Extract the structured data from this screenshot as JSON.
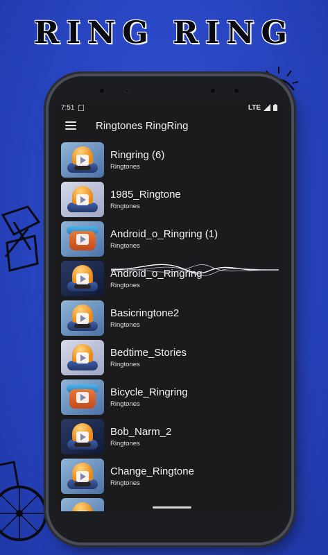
{
  "banner": {
    "title": "RING RING"
  },
  "status_bar": {
    "time": "7:51",
    "network": "LTE"
  },
  "toolbar": {
    "title": "Ringtones RingRing",
    "menu_icon": "hamburger-menu-icon"
  },
  "ringtones": [
    {
      "name": "Ringring (6)",
      "category": "Ringtones",
      "thumb": "bell"
    },
    {
      "name": "1985_Ringtone",
      "category": "Ringtones",
      "thumb": "alarm"
    },
    {
      "name": "Android_o_Ringring (1)",
      "category": "Ringtones",
      "thumb": "phone"
    },
    {
      "name": "Android_o_Ringring",
      "category": "Ringtones",
      "thumb": "dark",
      "playing": true
    },
    {
      "name": "Basicringtone2",
      "category": "Ringtones",
      "thumb": "bell"
    },
    {
      "name": "Bedtime_Stories",
      "category": "Ringtones",
      "thumb": "alarm"
    },
    {
      "name": "Bicycle_Ringring",
      "category": "Ringtones",
      "thumb": "phone"
    },
    {
      "name": "Bob_Narm_2",
      "category": "Ringtones",
      "thumb": "dark"
    },
    {
      "name": "Change_Ringtone",
      "category": "Ringtones",
      "thumb": "bell"
    },
    {
      "name": "",
      "category": "",
      "thumb": "bell"
    }
  ],
  "colors": {
    "background": "#2a47c4",
    "screen": "#1b1b1d",
    "accent_orange": "#e88a1a"
  }
}
